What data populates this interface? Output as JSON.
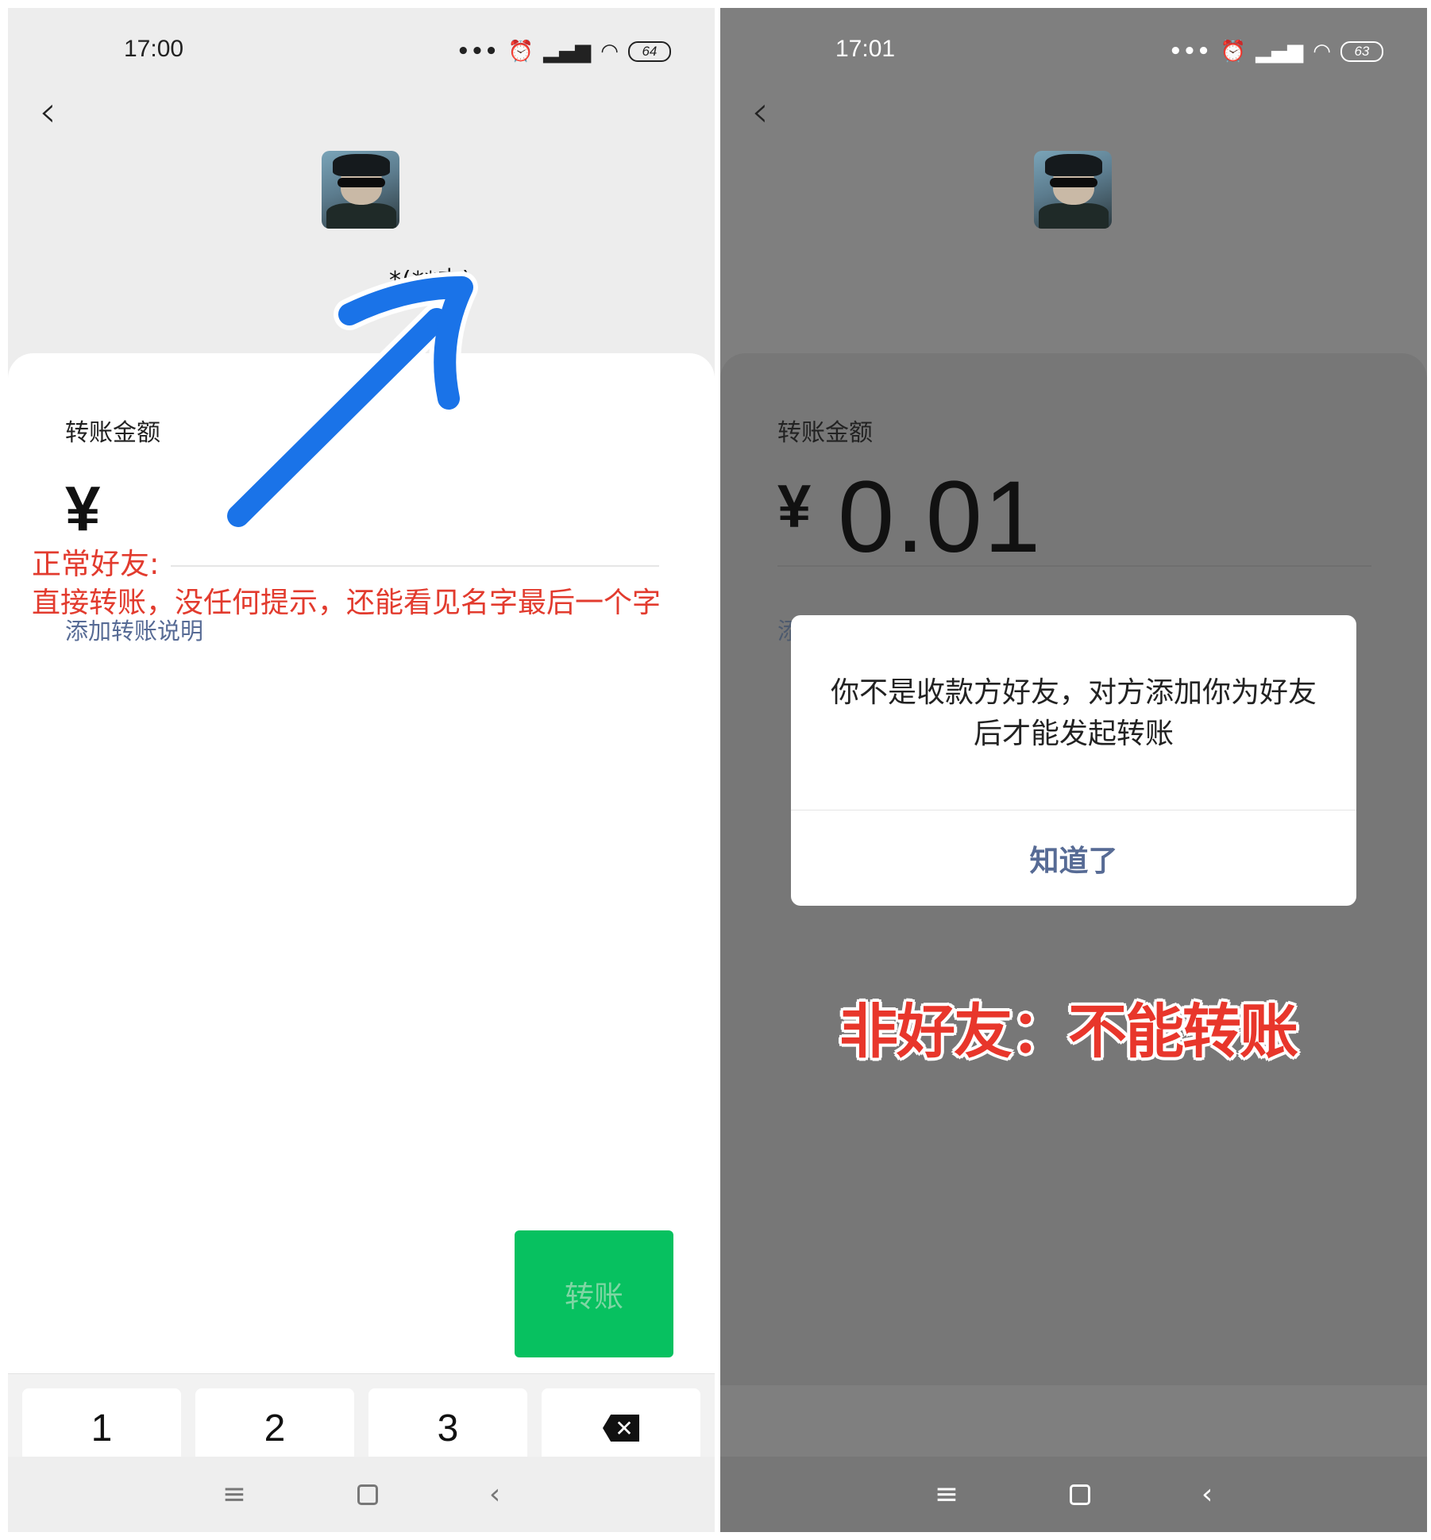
{
  "left": {
    "status": {
      "time": "17:00",
      "battery": "64"
    },
    "recipient_name": "*(**杰)",
    "amount_label": "转账金额",
    "currency": "¥",
    "amount_value": "",
    "add_note": "添加转账说明",
    "transfer_button": "转账",
    "keys": [
      "1",
      "2",
      "3"
    ],
    "delete_icon": "backspace-icon",
    "annotation": {
      "line1": "正常好友:",
      "line2": "直接转账，没任何提示，还能看见名字最后一个字",
      "arrow_color": "#1a73e8"
    }
  },
  "right": {
    "status": {
      "time": "17:01",
      "battery": "63"
    },
    "amount_label": "转账金额",
    "currency": "¥",
    "amount_value": "0.01",
    "add_note_partial": "添",
    "dialog": {
      "message": "你不是收款方好友，对方添加你为好友后才能发起转账",
      "button": "知道了"
    },
    "annotation": "非好友：不能转账"
  },
  "navbar": {
    "menu": "≡",
    "back": "‹"
  },
  "colors": {
    "wechat_green": "#07c160",
    "link_blue": "#576b95",
    "annotation_red": "#e23b2e"
  }
}
